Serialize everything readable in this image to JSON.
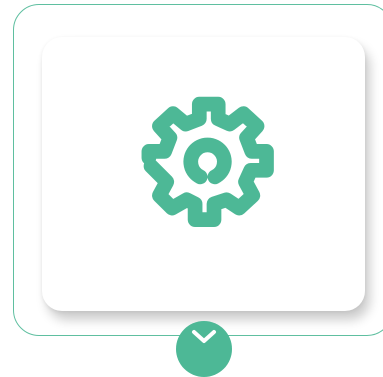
{
  "theme": {
    "accent": "#4db896",
    "frame_border": "#5fbfa0",
    "card_background": "#ffffff"
  },
  "card": {
    "icon": "gear-icon"
  },
  "bottom_toggle": {
    "icon": "chevron-down-icon"
  }
}
